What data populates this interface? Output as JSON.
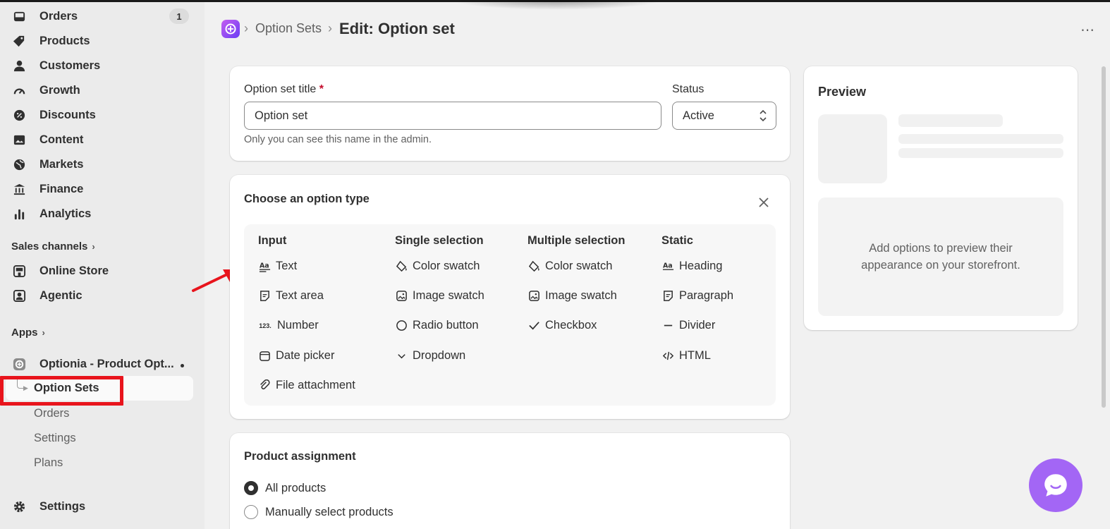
{
  "sidebar": {
    "nav": [
      {
        "label": "Orders",
        "icon": "inbox-icon",
        "badge": "1"
      },
      {
        "label": "Products",
        "icon": "tag-icon"
      },
      {
        "label": "Customers",
        "icon": "person-icon"
      },
      {
        "label": "Growth",
        "icon": "gauge-icon"
      },
      {
        "label": "Discounts",
        "icon": "discount-icon"
      },
      {
        "label": "Content",
        "icon": "image-icon"
      },
      {
        "label": "Markets",
        "icon": "globe-icon"
      },
      {
        "label": "Finance",
        "icon": "bank-icon"
      },
      {
        "label": "Analytics",
        "icon": "bar-chart-icon"
      }
    ],
    "sales_channels_label": "Sales channels",
    "channels": [
      {
        "label": "Online Store",
        "icon": "store-icon"
      },
      {
        "label": "Agentic",
        "icon": "agent-icon"
      }
    ],
    "apps_label": "Apps",
    "app": {
      "label": "Optionia - Product Opt...",
      "icon": "app-icon"
    },
    "app_sub": [
      "Option Sets",
      "Orders",
      "Settings",
      "Plans"
    ],
    "settings_label": "Settings"
  },
  "header": {
    "breadcrumb": "Option Sets",
    "title": "Edit: Option set",
    "more": "⋯"
  },
  "title_card": {
    "label": "Option set title",
    "required_mark": "*",
    "value": "Option set",
    "help": "Only you can see this name in the admin.",
    "status_label": "Status",
    "status_value": "Active"
  },
  "option_type_card": {
    "title": "Choose an option type",
    "columns": [
      {
        "heading": "Input",
        "items": [
          {
            "label": "Text",
            "icon": "text-icon"
          },
          {
            "label": "Text area",
            "icon": "text-area-icon"
          },
          {
            "label": "Number",
            "icon": "number-icon"
          },
          {
            "label": "Date picker",
            "icon": "calendar-icon"
          },
          {
            "label": "File attachment",
            "icon": "paperclip-icon"
          }
        ]
      },
      {
        "heading": "Single selection",
        "items": [
          {
            "label": "Color swatch",
            "icon": "paint-bucket-icon"
          },
          {
            "label": "Image swatch",
            "icon": "image-swatch-icon"
          },
          {
            "label": "Radio button",
            "icon": "radio-icon"
          },
          {
            "label": "Dropdown",
            "icon": "chevron-down-icon"
          }
        ]
      },
      {
        "heading": "Multiple selection",
        "items": [
          {
            "label": "Color swatch",
            "icon": "paint-bucket-icon"
          },
          {
            "label": "Image swatch",
            "icon": "image-swatch-icon"
          },
          {
            "label": "Checkbox",
            "icon": "checkmark-icon"
          }
        ]
      },
      {
        "heading": "Static",
        "items": [
          {
            "label": "Heading",
            "icon": "heading-icon"
          },
          {
            "label": "Paragraph",
            "icon": "paragraph-icon"
          },
          {
            "label": "Divider",
            "icon": "divider-icon"
          },
          {
            "label": "HTML",
            "icon": "code-icon"
          }
        ]
      }
    ],
    "number_glyph": "123."
  },
  "assignment_card": {
    "title": "Product assignment",
    "options": [
      {
        "label": "All products",
        "selected": true
      },
      {
        "label": "Manually select products",
        "selected": false
      }
    ]
  },
  "preview": {
    "title": "Preview",
    "empty_text": "Add options to preview their appearance on your storefront."
  },
  "colors": {
    "annotation_red": "#e8141c",
    "chat_purple": "#a366f5",
    "app_gradient": "#8a4df5"
  }
}
